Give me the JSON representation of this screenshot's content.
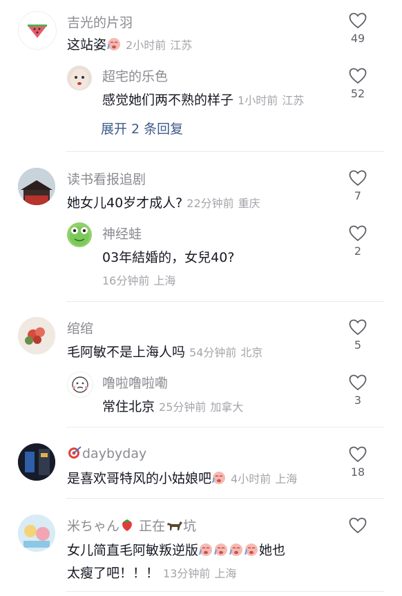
{
  "comments": [
    {
      "user": "吉光的片羽",
      "text": "这站姿",
      "time": "2小时前",
      "loc": "江苏",
      "likes": "49"
    },
    {
      "user": "超宅的乐色",
      "text": "感觉她们两不熟的样子",
      "time": "1小时前",
      "loc": "江苏",
      "likes": "52"
    },
    {
      "expand": "展开 2 条回复"
    },
    {
      "user": "读书看报追剧",
      "text": "她女儿40岁才成人?",
      "time": "22分钟前",
      "loc": "重庆",
      "likes": "7"
    },
    {
      "user": "神经蛙",
      "text": "03年結婚的，女兒40?",
      "time": "16分钟前",
      "loc": "上海",
      "likes": "2"
    },
    {
      "user": "绾绾",
      "text": "毛阿敏不是上海人吗",
      "time": "54分钟前",
      "loc": "北京",
      "likes": "5"
    },
    {
      "user": "噜啦噜啦嘞",
      "text": "常住北京",
      "time": "25分钟前",
      "loc": "加拿大",
      "likes": "3"
    },
    {
      "user": "daybyday",
      "text": "是喜欢哥特风的小姑娘吧",
      "time": "4小时前",
      "loc": "上海",
      "likes": "18"
    },
    {
      "user_a": "米ちゃん",
      "user_b": "正在",
      "user_c": "坑",
      "text_line1": "女儿简直毛阿敏叛逆版",
      "text_line1_tail": "她也",
      "text_line2": "太瘦了吧！！！",
      "time": "13分钟前",
      "loc": "上海"
    }
  ],
  "icons": {
    "like": "heart-outline-icon",
    "emoji_face": "crying-face-emoji"
  },
  "colors": {
    "name": "#8a8b91",
    "meta": "#a4a5aa",
    "link": "#3c5a89",
    "divider": "#e9e9ea"
  }
}
